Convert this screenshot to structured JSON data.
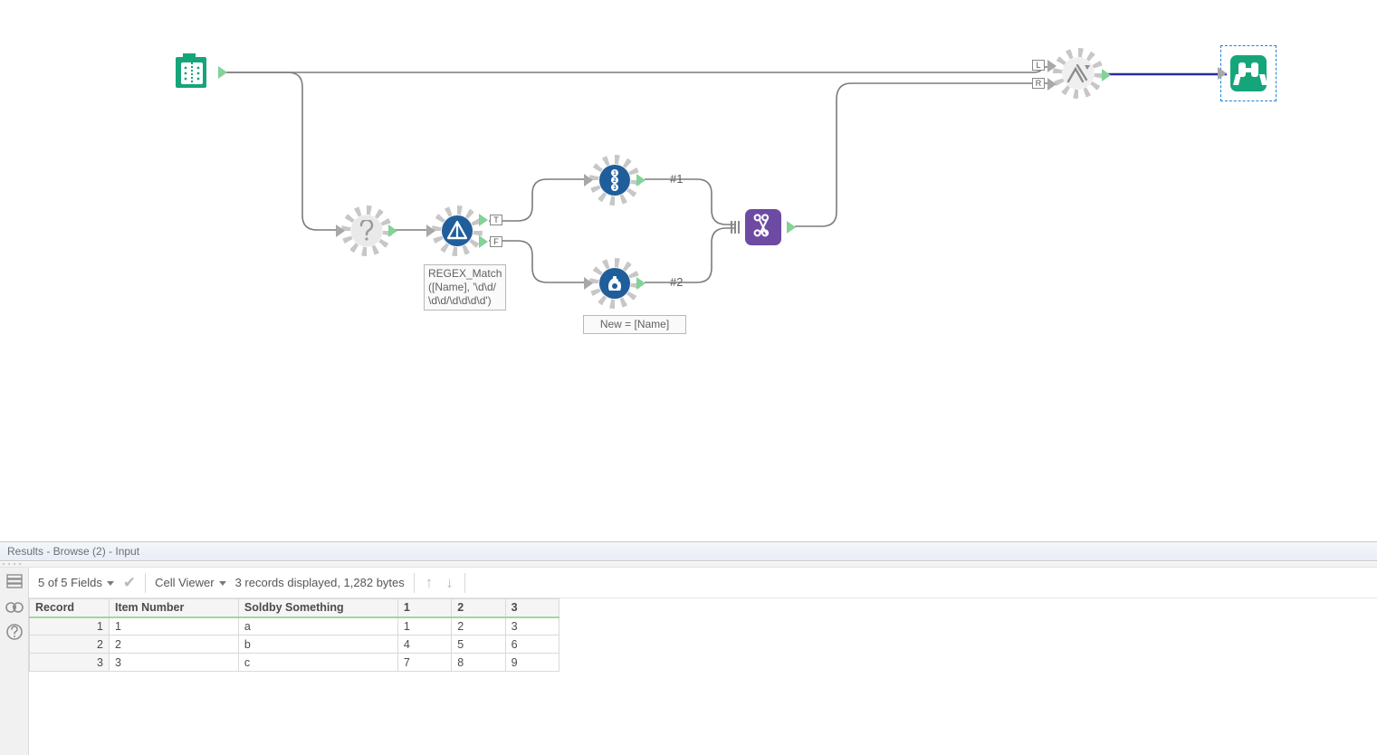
{
  "canvas": {
    "tools": {
      "input": {
        "type": "TextInput"
      },
      "question": {
        "type": "Unknown"
      },
      "filter": {
        "type": "Filter",
        "annotation": "REGEX_Match\n([Name], '\\d\\d/\n\\d\\d/\\d\\d\\d\\d')"
      },
      "recordid": {
        "type": "RecordID"
      },
      "formula": {
        "type": "Formula",
        "annotation": "New = [Name]"
      },
      "union": {
        "type": "Union"
      },
      "join": {
        "type": "Join"
      },
      "browse": {
        "type": "Browse"
      }
    },
    "port_labels": {
      "T": "T",
      "F": "F",
      "L": "L",
      "R": "R"
    },
    "hash1": "#1",
    "hash2": "#2"
  },
  "results": {
    "title": "Results - Browse (2) - Input",
    "toolbar": {
      "fields": "5 of 5 Fields",
      "cellviewer": "Cell Viewer",
      "summary": "3 records displayed, 1,282 bytes"
    },
    "columns": [
      "Record",
      "Item Number",
      "Soldby Something",
      "1",
      "2",
      "3"
    ],
    "rows": [
      {
        "Record": "1",
        "Item Number": "1",
        "Soldby Something": "a",
        "1": "1",
        "2": "2",
        "3": "3"
      },
      {
        "Record": "2",
        "Item Number": "2",
        "Soldby Something": "b",
        "1": "4",
        "2": "5",
        "3": "6"
      },
      {
        "Record": "3",
        "Item Number": "3",
        "Soldby Something": "c",
        "1": "7",
        "2": "8",
        "3": "9"
      }
    ]
  }
}
